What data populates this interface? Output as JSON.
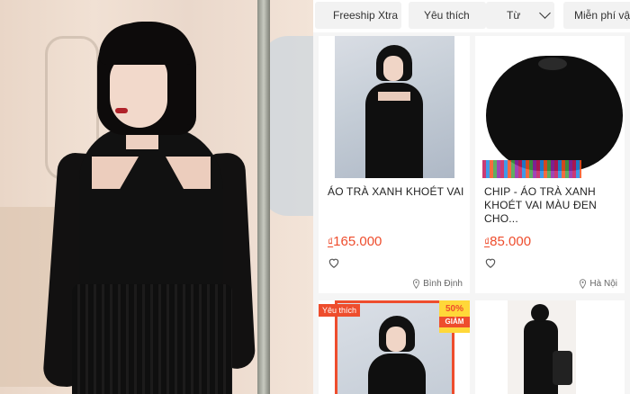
{
  "filters": [
    {
      "label": "Freeship Xtra"
    },
    {
      "label": "Yêu thích"
    },
    {
      "label": "Từ"
    },
    {
      "label": "Miễn phí vận"
    }
  ],
  "products": [
    {
      "title": "ÁO TRÀ XANH KHOÉT VAI",
      "currency": "₫",
      "price": "165.000",
      "location": "Bình Định"
    },
    {
      "title": "CHIP - ÁO TRÀ XANH KHOÉT VAI MÀU ĐEN CHO...",
      "currency": "₫",
      "price": "85.000",
      "location": "Hà Nội"
    },
    {
      "badge": "Yêu thích",
      "discount": "50%",
      "discount_label": "GIẢM"
    },
    {}
  ],
  "colors": {
    "accent": "#ee4d2d",
    "sale_badge": "#ffd839"
  },
  "icons": [
    "chevron-down-icon",
    "heart-icon",
    "location-pin-icon"
  ]
}
